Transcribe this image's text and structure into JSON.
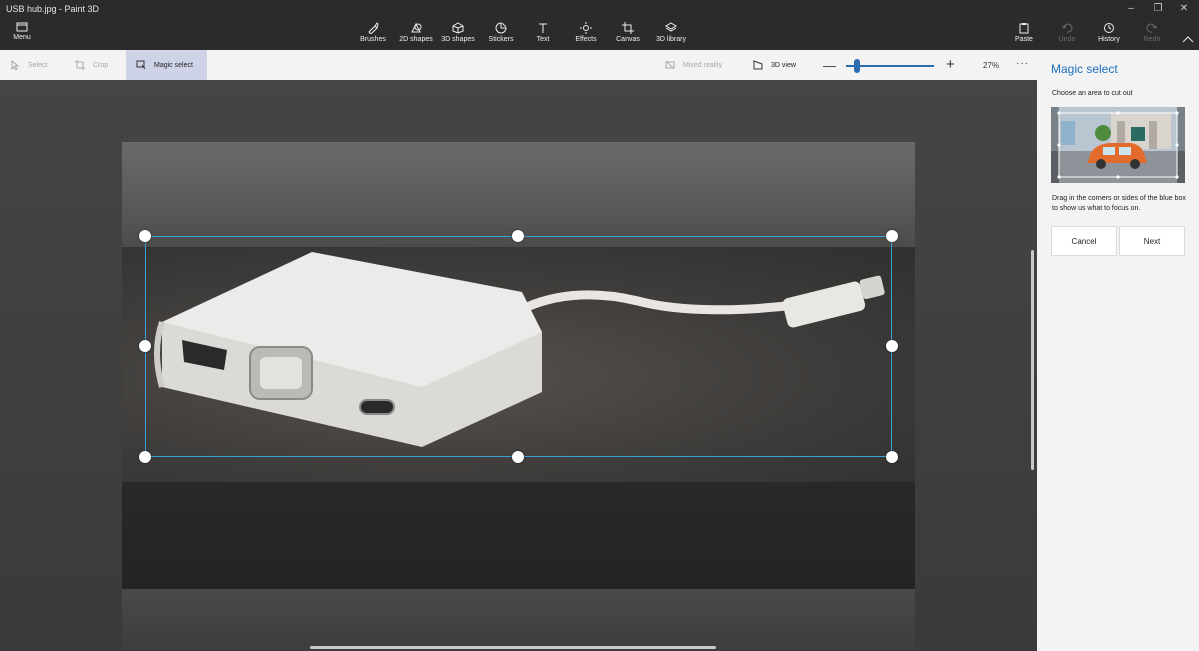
{
  "window": {
    "title": "USB hub.jpg - Paint 3D",
    "controls": {
      "minimize": "–",
      "restore": "❐",
      "close": "✕"
    }
  },
  "toolbar": {
    "menu_label": "Menu",
    "tools": [
      {
        "label": "Brushes",
        "icon": "brush-icon"
      },
      {
        "label": "2D shapes",
        "icon": "2d-shapes-icon"
      },
      {
        "label": "3D shapes",
        "icon": "3d-shapes-icon"
      },
      {
        "label": "Stickers",
        "icon": "stickers-icon"
      },
      {
        "label": "Text",
        "icon": "text-icon"
      },
      {
        "label": "Effects",
        "icon": "effects-icon"
      },
      {
        "label": "Canvas",
        "icon": "canvas-icon"
      },
      {
        "label": "3D library",
        "icon": "3d-library-icon"
      }
    ],
    "right": [
      {
        "label": "Paste",
        "icon": "paste-icon",
        "enabled": true
      },
      {
        "label": "Undo",
        "icon": "undo-icon",
        "enabled": false
      },
      {
        "label": "History",
        "icon": "history-icon",
        "enabled": true
      },
      {
        "label": "Redo",
        "icon": "redo-icon",
        "enabled": false
      }
    ],
    "collapse_icon": "chevron-up-icon"
  },
  "subtoolbar": {
    "select_label": "Select",
    "crop_label": "Crop",
    "magic_select_label": "Magic select",
    "mixed_reality_label": "Mixed reality",
    "view_3d_label": "3D view",
    "zoom_minus": "—",
    "zoom_plus": "+",
    "zoom_fraction": 0.12,
    "zoom_level": "27%",
    "more": "···"
  },
  "panel": {
    "title": "Magic select",
    "subtitle": "Choose an area to cut out",
    "help": "Drag in the corners or sides of the blue box to show us what to focus on.",
    "cancel_label": "Cancel",
    "next_label": "Next"
  },
  "colors": {
    "accent": "#1b6fbf",
    "selection": "#3aa0d8",
    "titlebar": "#2b2b2b",
    "panel": "#f3f3f3"
  }
}
